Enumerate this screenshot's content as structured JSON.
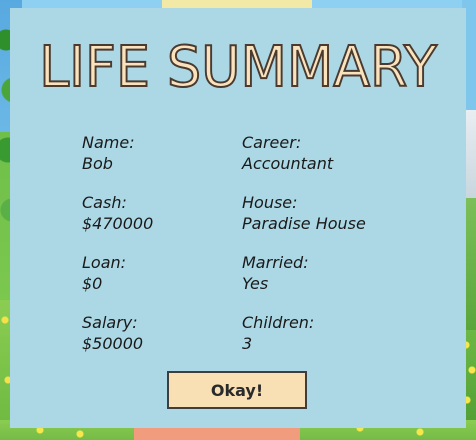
{
  "title": "LIFE SUMMARY",
  "fields": {
    "name": {
      "label": "Name:",
      "value": "Bob"
    },
    "career": {
      "label": "Career:",
      "value": "Accountant"
    },
    "cash": {
      "label": "Cash:",
      "value": "$470000"
    },
    "house": {
      "label": "House:",
      "value": "Paradise House"
    },
    "loan": {
      "label": "Loan:",
      "value": "$0"
    },
    "married": {
      "label": "Married:",
      "value": "Yes"
    },
    "salary": {
      "label": "Salary:",
      "value": "$50000"
    },
    "children": {
      "label": "Children:",
      "value": "3"
    }
  },
  "button": {
    "label": "Okay!"
  },
  "colors": {
    "panel_background": "#acd8e5",
    "title_fill": "#fae3bc",
    "title_outline": "#4a3a30",
    "button_background": "#f8dfb4",
    "button_border": "#3e3e3e"
  }
}
